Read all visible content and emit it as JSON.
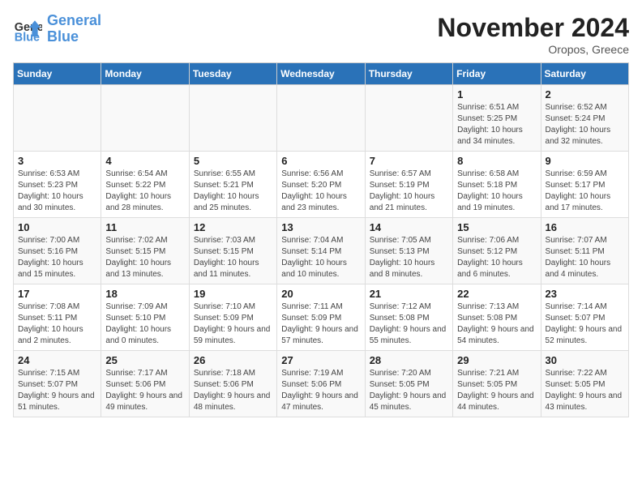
{
  "logo": {
    "line1": "General",
    "line2": "Blue"
  },
  "title": "November 2024",
  "location": "Oropos, Greece",
  "headers": [
    "Sunday",
    "Monday",
    "Tuesday",
    "Wednesday",
    "Thursday",
    "Friday",
    "Saturday"
  ],
  "weeks": [
    [
      {
        "day": "",
        "info": ""
      },
      {
        "day": "",
        "info": ""
      },
      {
        "day": "",
        "info": ""
      },
      {
        "day": "",
        "info": ""
      },
      {
        "day": "",
        "info": ""
      },
      {
        "day": "1",
        "info": "Sunrise: 6:51 AM\nSunset: 5:25 PM\nDaylight: 10 hours and 34 minutes."
      },
      {
        "day": "2",
        "info": "Sunrise: 6:52 AM\nSunset: 5:24 PM\nDaylight: 10 hours and 32 minutes."
      }
    ],
    [
      {
        "day": "3",
        "info": "Sunrise: 6:53 AM\nSunset: 5:23 PM\nDaylight: 10 hours and 30 minutes."
      },
      {
        "day": "4",
        "info": "Sunrise: 6:54 AM\nSunset: 5:22 PM\nDaylight: 10 hours and 28 minutes."
      },
      {
        "day": "5",
        "info": "Sunrise: 6:55 AM\nSunset: 5:21 PM\nDaylight: 10 hours and 25 minutes."
      },
      {
        "day": "6",
        "info": "Sunrise: 6:56 AM\nSunset: 5:20 PM\nDaylight: 10 hours and 23 minutes."
      },
      {
        "day": "7",
        "info": "Sunrise: 6:57 AM\nSunset: 5:19 PM\nDaylight: 10 hours and 21 minutes."
      },
      {
        "day": "8",
        "info": "Sunrise: 6:58 AM\nSunset: 5:18 PM\nDaylight: 10 hours and 19 minutes."
      },
      {
        "day": "9",
        "info": "Sunrise: 6:59 AM\nSunset: 5:17 PM\nDaylight: 10 hours and 17 minutes."
      }
    ],
    [
      {
        "day": "10",
        "info": "Sunrise: 7:00 AM\nSunset: 5:16 PM\nDaylight: 10 hours and 15 minutes."
      },
      {
        "day": "11",
        "info": "Sunrise: 7:02 AM\nSunset: 5:15 PM\nDaylight: 10 hours and 13 minutes."
      },
      {
        "day": "12",
        "info": "Sunrise: 7:03 AM\nSunset: 5:15 PM\nDaylight: 10 hours and 11 minutes."
      },
      {
        "day": "13",
        "info": "Sunrise: 7:04 AM\nSunset: 5:14 PM\nDaylight: 10 hours and 10 minutes."
      },
      {
        "day": "14",
        "info": "Sunrise: 7:05 AM\nSunset: 5:13 PM\nDaylight: 10 hours and 8 minutes."
      },
      {
        "day": "15",
        "info": "Sunrise: 7:06 AM\nSunset: 5:12 PM\nDaylight: 10 hours and 6 minutes."
      },
      {
        "day": "16",
        "info": "Sunrise: 7:07 AM\nSunset: 5:11 PM\nDaylight: 10 hours and 4 minutes."
      }
    ],
    [
      {
        "day": "17",
        "info": "Sunrise: 7:08 AM\nSunset: 5:11 PM\nDaylight: 10 hours and 2 minutes."
      },
      {
        "day": "18",
        "info": "Sunrise: 7:09 AM\nSunset: 5:10 PM\nDaylight: 10 hours and 0 minutes."
      },
      {
        "day": "19",
        "info": "Sunrise: 7:10 AM\nSunset: 5:09 PM\nDaylight: 9 hours and 59 minutes."
      },
      {
        "day": "20",
        "info": "Sunrise: 7:11 AM\nSunset: 5:09 PM\nDaylight: 9 hours and 57 minutes."
      },
      {
        "day": "21",
        "info": "Sunrise: 7:12 AM\nSunset: 5:08 PM\nDaylight: 9 hours and 55 minutes."
      },
      {
        "day": "22",
        "info": "Sunrise: 7:13 AM\nSunset: 5:08 PM\nDaylight: 9 hours and 54 minutes."
      },
      {
        "day": "23",
        "info": "Sunrise: 7:14 AM\nSunset: 5:07 PM\nDaylight: 9 hours and 52 minutes."
      }
    ],
    [
      {
        "day": "24",
        "info": "Sunrise: 7:15 AM\nSunset: 5:07 PM\nDaylight: 9 hours and 51 minutes."
      },
      {
        "day": "25",
        "info": "Sunrise: 7:17 AM\nSunset: 5:06 PM\nDaylight: 9 hours and 49 minutes."
      },
      {
        "day": "26",
        "info": "Sunrise: 7:18 AM\nSunset: 5:06 PM\nDaylight: 9 hours and 48 minutes."
      },
      {
        "day": "27",
        "info": "Sunrise: 7:19 AM\nSunset: 5:06 PM\nDaylight: 9 hours and 47 minutes."
      },
      {
        "day": "28",
        "info": "Sunrise: 7:20 AM\nSunset: 5:05 PM\nDaylight: 9 hours and 45 minutes."
      },
      {
        "day": "29",
        "info": "Sunrise: 7:21 AM\nSunset: 5:05 PM\nDaylight: 9 hours and 44 minutes."
      },
      {
        "day": "30",
        "info": "Sunrise: 7:22 AM\nSunset: 5:05 PM\nDaylight: 9 hours and 43 minutes."
      }
    ]
  ]
}
